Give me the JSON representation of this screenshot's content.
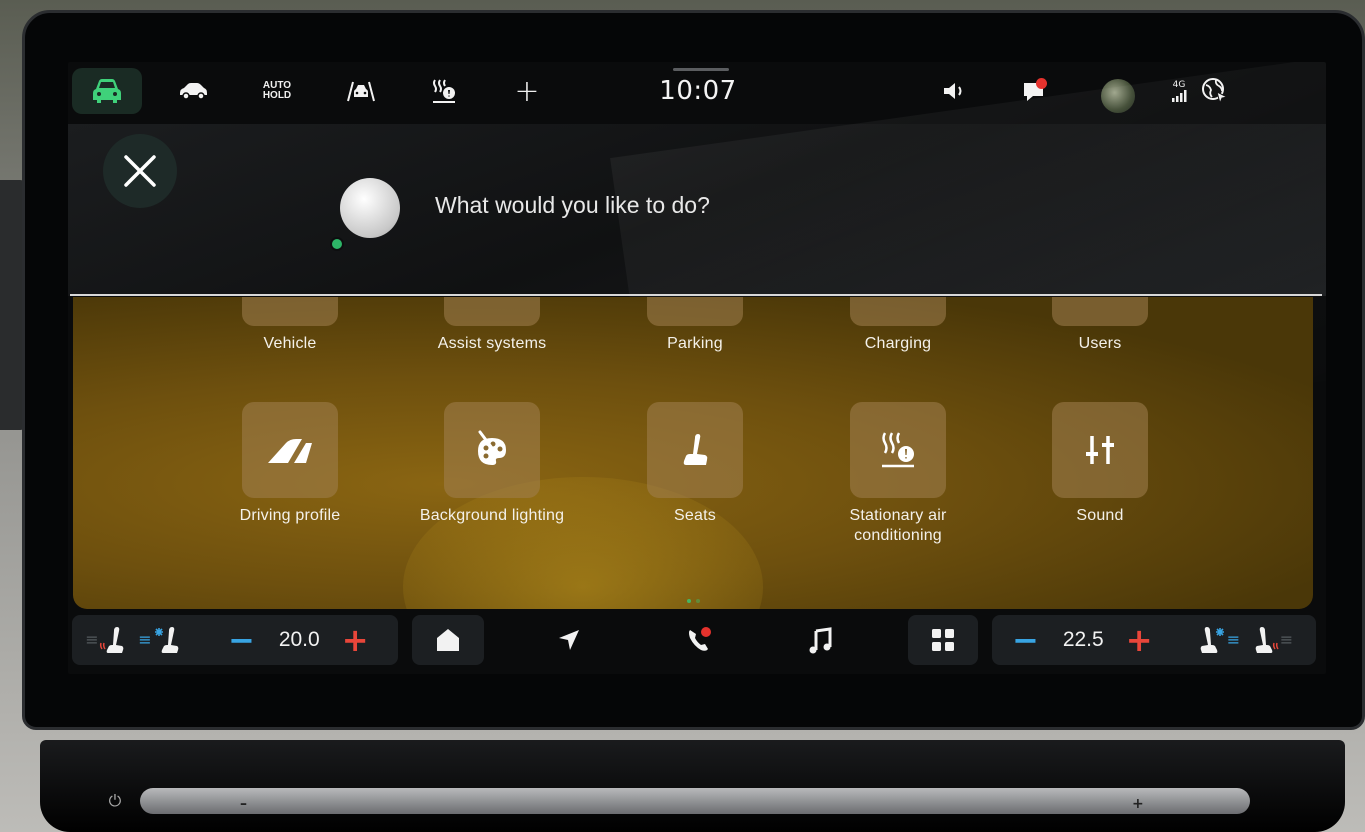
{
  "status_bar": {
    "auto_hold_line1": "AUTO",
    "auto_hold_line2": "HOLD",
    "clock": "10:07",
    "network_label": "4G",
    "icons": [
      "car-icon",
      "vehicle-status-icon",
      "auto-hold-icon",
      "lane-assist-icon",
      "stationary-heating-icon",
      "add-icon",
      "volume-icon",
      "notifications-icon",
      "user-avatar",
      "signal-icon",
      "navigation-online-icon"
    ],
    "active_color": "#3fd17a",
    "notification_color": "#e5322d"
  },
  "assistant": {
    "prompt": "What would you like to do?",
    "indicator_color": "#2db567"
  },
  "menu": {
    "top_row": [
      {
        "label": "Vehicle"
      },
      {
        "label": "Assist systems"
      },
      {
        "label": "Parking"
      },
      {
        "label": "Charging"
      },
      {
        "label": "Users"
      }
    ],
    "bottom_row": [
      {
        "label": "Driving profile",
        "icon": "road-profile-icon"
      },
      {
        "label": "Background lighting",
        "icon": "palette-icon"
      },
      {
        "label": "Seats",
        "icon": "seat-icon"
      },
      {
        "label": "Stationary air conditioning",
        "icon": "stationary-heating-icon"
      },
      {
        "label": "Sound",
        "icon": "equalizer-icon"
      }
    ],
    "background_color": "#6e500e",
    "page_count": 2,
    "active_page": 1
  },
  "climate": {
    "left_temp": "20.0",
    "right_temp": "22.5",
    "minus_color": "#38a4e3",
    "plus_color": "#e8463a",
    "nav_icons": [
      "home-icon",
      "navigation-icon",
      "phone-icon",
      "music-icon",
      "apps-grid-icon"
    ]
  }
}
